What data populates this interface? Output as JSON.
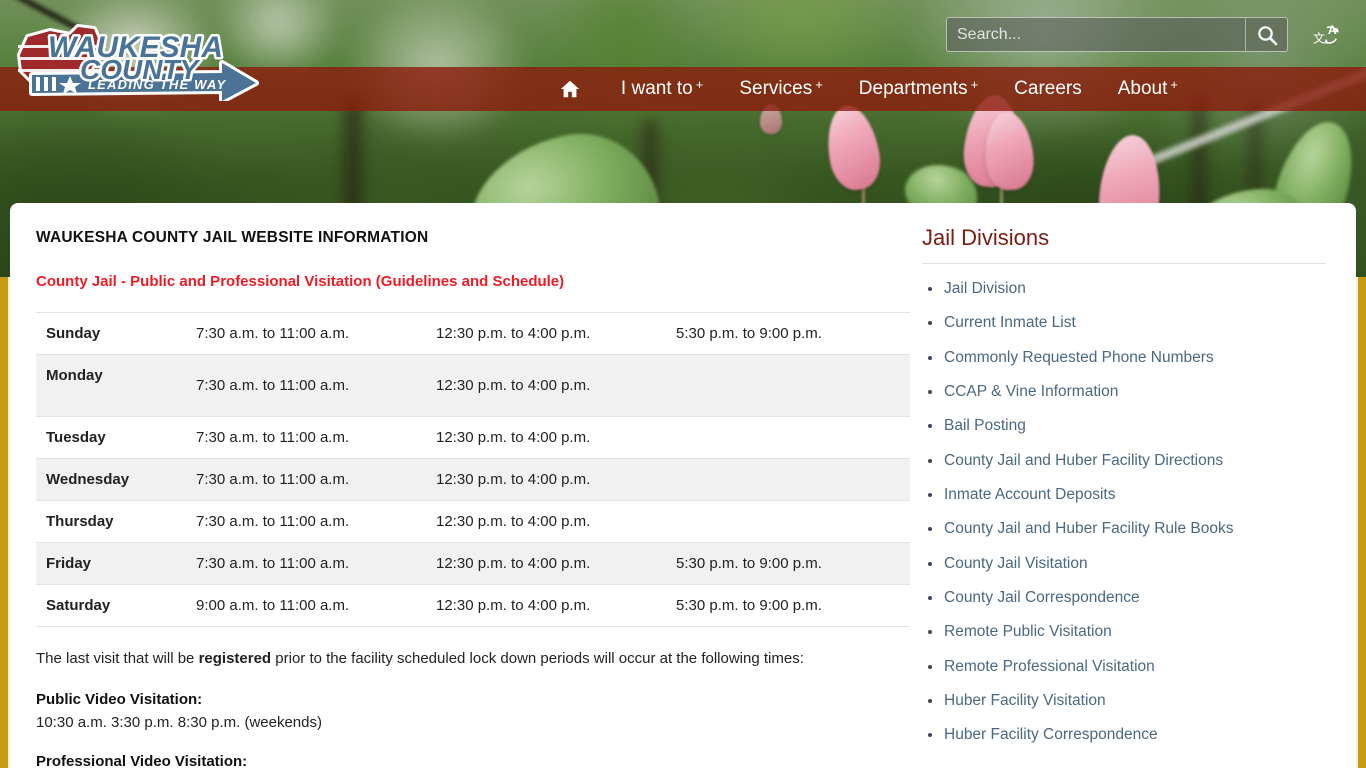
{
  "header": {
    "logo": {
      "line1": "WAUKESHA",
      "line2": "COUNTY",
      "tagline": "LEADING THE WAY"
    },
    "search": {
      "placeholder": "Search...",
      "value": "",
      "search_icon": "magnifier-icon",
      "translate_icon": "translate-icon"
    },
    "nav": [
      {
        "label": "",
        "icon": "home-icon",
        "plus": ""
      },
      {
        "label": "I want to",
        "icon": "",
        "plus": "+"
      },
      {
        "label": "Services",
        "icon": "",
        "plus": "+"
      },
      {
        "label": "Departments",
        "icon": "",
        "plus": "+"
      },
      {
        "label": "Careers",
        "icon": "",
        "plus": ""
      },
      {
        "label": "About",
        "icon": "",
        "plus": "+"
      }
    ]
  },
  "main": {
    "page_title": "WAUKESHA COUNTY JAIL WEBSITE INFORMATION",
    "subtitle": "County Jail - Public and Professional Visitation (Guidelines and Schedule)",
    "schedule": [
      {
        "day": "Sunday",
        "slots": [
          "7:30 a.m. to 11:00 a.m.",
          "12:30 p.m. to 4:00 p.m.",
          "5:30 p.m. to 9:00 p.m."
        ]
      },
      {
        "day": "Monday",
        "slots": [
          "7:30 a.m. to 11:00 a.m.",
          "12:30 p.m. to 4:00 p.m.",
          ""
        ]
      },
      {
        "day": "Tuesday",
        "slots": [
          "7:30 a.m. to 11:00 a.m.",
          "12:30 p.m. to 4:00 p.m.",
          ""
        ]
      },
      {
        "day": "Wednesday",
        "slots": [
          "7:30 a.m. to 11:00 a.m.",
          "12:30 p.m. to 4:00 p.m.",
          ""
        ]
      },
      {
        "day": "Thursday",
        "slots": [
          "7:30 a.m. to 11:00 a.m.",
          "12:30 p.m. to 4:00 p.m.",
          ""
        ]
      },
      {
        "day": "Friday",
        "slots": [
          "7:30 a.m. to 11:00 a.m.",
          "12:30 p.m. to 4:00 p.m.",
          "5:30 p.m. to 9:00 p.m."
        ]
      },
      {
        "day": "Saturday",
        "slots": [
          "9:00 a.m. to 11:00 a.m.",
          "12:30 p.m. to 4:00 p.m.",
          "5:30 p.m. to 9:00 p.m."
        ]
      }
    ],
    "note": {
      "pre": "The last visit that will be ",
      "bold": "registered",
      "post": " prior to the facility scheduled lock down periods will occur at the following times:"
    },
    "public_video_heading": "Public Video Visitation:",
    "public_video_times": "10:30 a.m. 3:30 p.m. 8:30 p.m. (weekends)",
    "professional_video_heading": "Professional Video Visitation:"
  },
  "sidebar": {
    "title": "Jail Divisions",
    "links": [
      "Jail Division",
      "Current Inmate List",
      "Commonly Requested Phone Numbers",
      "CCAP & Vine Information",
      "Bail Posting",
      "County Jail and Huber Facility Directions",
      "Inmate Account Deposits",
      "County Jail and Huber Facility Rule Books",
      "County Jail Visitation",
      "County Jail Correspondence",
      "Remote Public Visitation",
      "Remote Professional Visitation",
      "Huber Facility Visitation",
      "Huber Facility Correspondence"
    ]
  },
  "colors": {
    "nav_bar": "#8c1c0c",
    "accent_red": "#ed1c24",
    "sidebar_title": "#7a1c12",
    "link_blue": "#4a6880",
    "gold_strip": "#c79a12",
    "logo_blue": "#4a7396",
    "logo_red": "#9e2a2b"
  }
}
